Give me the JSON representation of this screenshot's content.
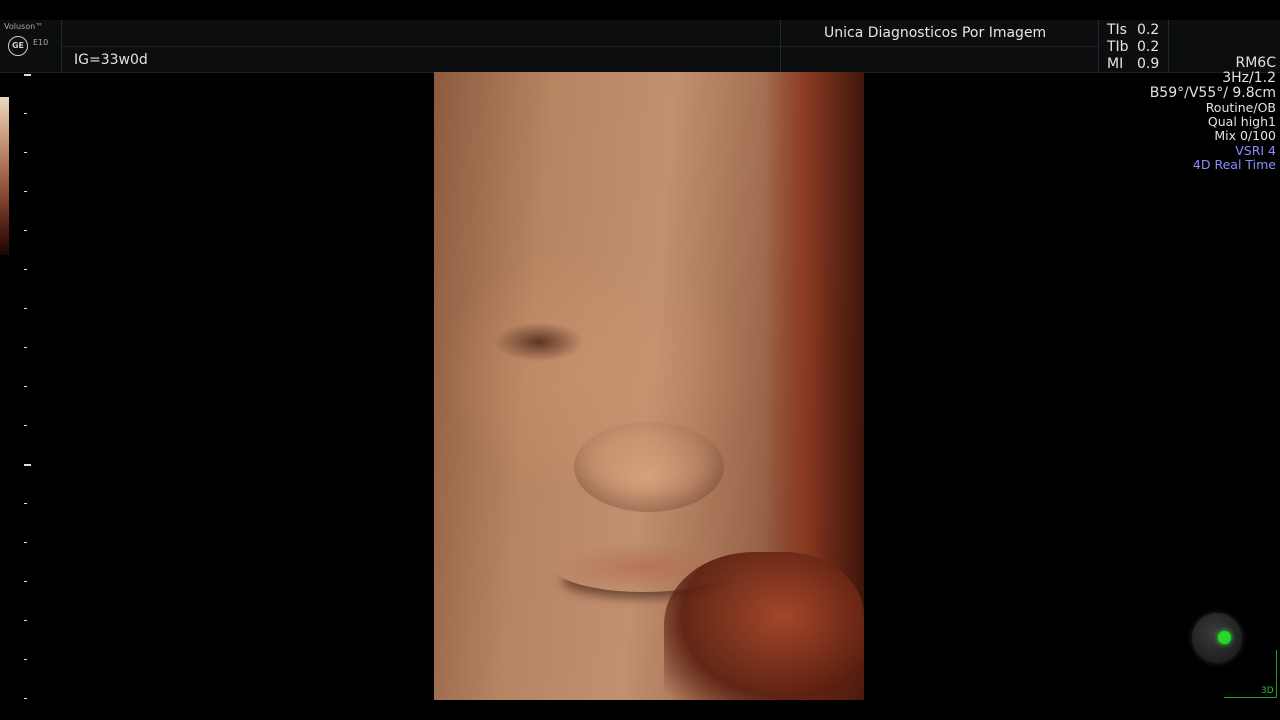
{
  "brand": {
    "name": "Voluson™",
    "logo": "GE",
    "model": "E10"
  },
  "gestational_age": "IG=33w0d",
  "institution": "Unica Diagnosticos Por Imagem",
  "indices": [
    {
      "label": "TIs",
      "value": "0.2"
    },
    {
      "label": "TIb",
      "value": "0.2"
    },
    {
      "label": "MI",
      "value": "0.9"
    }
  ],
  "params": {
    "probe": "RM6C",
    "frame_rate": "3Hz/1.2",
    "volume_angle": "B59°/V55°/ 9.8cm",
    "preset": "Routine/OB",
    "quality": "Qual high1",
    "mix": "Mix 0/100",
    "vsri": "VSRI 4",
    "mode": "4D Real Time"
  },
  "colors": {
    "accent_blue": "#8a8cff",
    "status_green": "#27d727",
    "background": "#000000"
  },
  "icons": {
    "orb": "render-direction-icon"
  },
  "view_label": "3D"
}
